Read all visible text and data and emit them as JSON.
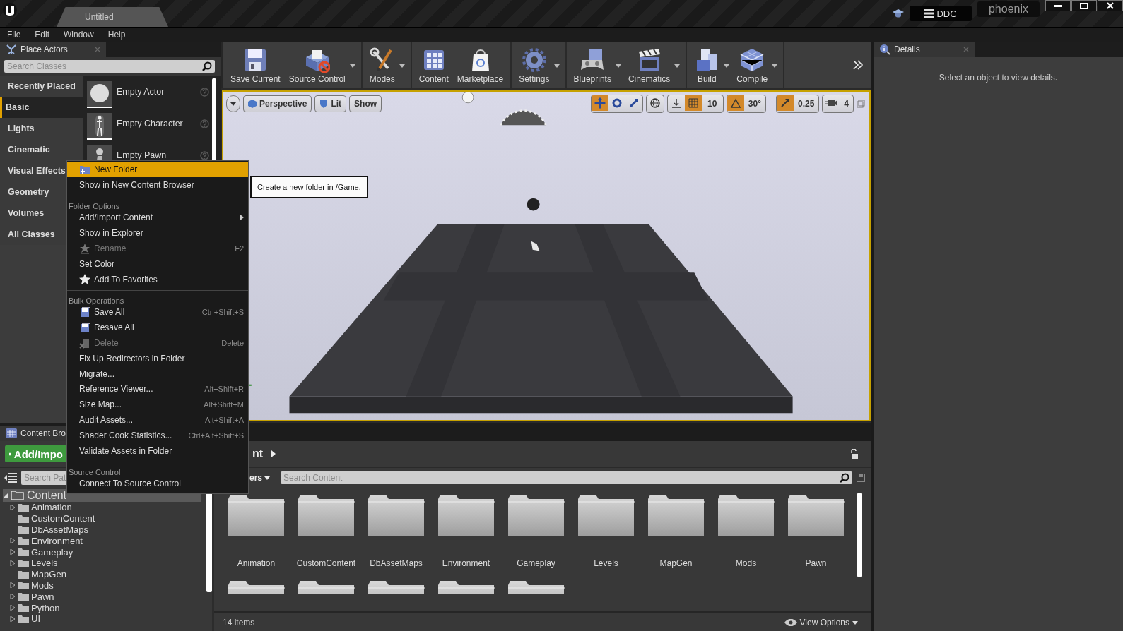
{
  "title_bar": {
    "tabs": [
      {
        "label": "Untitled",
        "selected": true
      }
    ],
    "ddc": "DDC",
    "user": "phoenix"
  },
  "menu": [
    "File",
    "Edit",
    "Window",
    "Help"
  ],
  "place_actors": {
    "tab": "Place Actors",
    "search": {
      "placeholder": "Search Classes"
    },
    "categories": [
      {
        "label": "Recently Placed",
        "selected": false
      },
      {
        "label": "Basic",
        "selected": true
      },
      {
        "label": "Lights",
        "selected": false
      },
      {
        "label": "Cinematic",
        "selected": false
      },
      {
        "label": "Visual Effects",
        "selected": false
      },
      {
        "label": "Geometry",
        "selected": false
      },
      {
        "label": "Volumes",
        "selected": false
      },
      {
        "label": "All Classes",
        "selected": false
      }
    ],
    "actors": [
      {
        "label": "Empty Actor",
        "kind": "sphere"
      },
      {
        "label": "Empty Character",
        "kind": "figure"
      },
      {
        "label": "Empty Pawn",
        "kind": "pawn"
      }
    ]
  },
  "toolbar": {
    "groups": [
      {
        "items": [
          {
            "label": "Save Current",
            "dropdown": false
          },
          {
            "label": "Source Control",
            "dropdown": true
          }
        ]
      },
      {
        "items": [
          {
            "label": "Modes",
            "dropdown": true
          }
        ]
      },
      {
        "items": [
          {
            "label": "Content",
            "dropdown": false
          },
          {
            "label": "Marketplace",
            "dropdown": false
          }
        ]
      },
      {
        "items": [
          {
            "label": "Settings",
            "dropdown": true
          }
        ]
      },
      {
        "items": [
          {
            "label": "Blueprints",
            "dropdown": true
          },
          {
            "label": "Cinematics",
            "dropdown": true
          }
        ]
      },
      {
        "items": [
          {
            "label": "Build",
            "dropdown": true
          },
          {
            "label": "Compile",
            "dropdown": true
          }
        ]
      }
    ]
  },
  "viewport": {
    "view_mode": "Perspective",
    "lighting": "Lit",
    "show": "Show",
    "transform_modes": [
      {
        "selected": true
      },
      {
        "selected": false
      },
      {
        "selected": false
      }
    ],
    "grid_snap": {
      "on": true,
      "value": "10"
    },
    "rotation_snap": {
      "on": true,
      "value": "30°"
    },
    "scale_snap": {
      "on": true,
      "value": "0.25"
    },
    "camera_speed": "4"
  },
  "details": {
    "tab": "Details",
    "message": "Select an object to view details."
  },
  "content_browser": {
    "tab": "Content Bro",
    "add_button": "Add/Impo",
    "breadcrumb": "nt",
    "path_search": {
      "placeholder": "Search Pat"
    },
    "filters": "ers",
    "search": {
      "placeholder": "Search Content"
    },
    "tree": [
      {
        "label": "Content",
        "kind": "expanded",
        "selected": true,
        "children": [
          {
            "label": "Animation",
            "kind": "collapsed",
            "selected": false
          },
          {
            "label": "CustomContent",
            "kind": "leaf",
            "selected": false
          },
          {
            "label": "DbAssetMaps",
            "kind": "leaf",
            "selected": false
          },
          {
            "label": "Environment",
            "kind": "collapsed",
            "selected": false
          },
          {
            "label": "Gameplay",
            "kind": "collapsed",
            "selected": false
          },
          {
            "label": "Levels",
            "kind": "collapsed",
            "selected": false
          },
          {
            "label": "MapGen",
            "kind": "leaf",
            "selected": false
          },
          {
            "label": "Mods",
            "kind": "collapsed",
            "selected": false
          },
          {
            "label": "Pawn",
            "kind": "collapsed",
            "selected": false
          },
          {
            "label": "Python",
            "kind": "collapsed",
            "selected": false
          },
          {
            "label": "UI",
            "kind": "collapsed",
            "selected": false
          }
        ]
      }
    ],
    "folders": [
      {
        "label": "Animation"
      },
      {
        "label": "CustomContent"
      },
      {
        "label": "DbAssetMaps"
      },
      {
        "label": "Environment"
      },
      {
        "label": "Gameplay"
      },
      {
        "label": "Levels"
      },
      {
        "label": "MapGen"
      },
      {
        "label": "Mods"
      },
      {
        "label": "Pawn"
      }
    ],
    "more_folders": [
      {
        "kind": "folder"
      },
      {
        "kind": "folder"
      },
      {
        "kind": "folder"
      },
      {
        "kind": "folder"
      },
      {
        "kind": "folder"
      }
    ],
    "item_count": "14 items",
    "view_options": "View Options"
  },
  "context_menu": {
    "sections": [
      {
        "items": [
          {
            "kind": "new-folder",
            "label": "New Folder",
            "selected": true,
            "disabled": false
          },
          {
            "kind": "plain",
            "label": "Show in New Content Browser",
            "selected": false,
            "disabled": false
          }
        ]
      },
      {
        "heading": "Folder Options",
        "items": [
          {
            "kind": "submenu",
            "label": "Add/Import Content",
            "selected": false,
            "disabled": false
          },
          {
            "kind": "plain",
            "label": "Show in Explorer",
            "selected": false,
            "disabled": false
          },
          {
            "kind": "rename",
            "label": "Rename",
            "shortcut": "F2",
            "selected": false,
            "disabled": true
          },
          {
            "kind": "plain",
            "label": "Set Color",
            "selected": false,
            "disabled": false
          },
          {
            "kind": "favorite",
            "label": "Add To Favorites",
            "selected": false,
            "disabled": false
          }
        ]
      },
      {
        "heading": "Bulk Operations",
        "items": [
          {
            "kind": "save",
            "label": "Save All",
            "shortcut": "Ctrl+Shift+S",
            "selected": false,
            "disabled": false
          },
          {
            "kind": "save",
            "label": "Resave All",
            "selected": false,
            "disabled": false
          },
          {
            "kind": "delete",
            "label": "Delete",
            "shortcut": "Delete",
            "selected": false,
            "disabled": true
          },
          {
            "kind": "plain",
            "label": "Fix Up Redirectors in Folder",
            "selected": false,
            "disabled": false
          },
          {
            "kind": "plain",
            "label": "Migrate...",
            "selected": false,
            "disabled": false
          },
          {
            "kind": "plain",
            "label": "Reference Viewer...",
            "shortcut": "Alt+Shift+R",
            "selected": false,
            "disabled": false
          },
          {
            "kind": "plain",
            "label": "Size Map...",
            "shortcut": "Alt+Shift+M",
            "selected": false,
            "disabled": false
          },
          {
            "kind": "plain",
            "label": "Audit Assets...",
            "shortcut": "Alt+Shift+A",
            "selected": false,
            "disabled": false
          },
          {
            "kind": "plain",
            "label": "Shader Cook Statistics...",
            "shortcut": "Ctrl+Alt+Shift+S",
            "selected": false,
            "disabled": false
          },
          {
            "kind": "plain",
            "label": "Validate Assets in Folder",
            "selected": false,
            "disabled": false
          }
        ]
      },
      {
        "heading": "Source Control",
        "items": [
          {
            "kind": "plain",
            "label": "Connect To Source Control",
            "selected": false,
            "disabled": false
          }
        ]
      }
    ]
  },
  "tooltip": "Create a new folder in /Game."
}
